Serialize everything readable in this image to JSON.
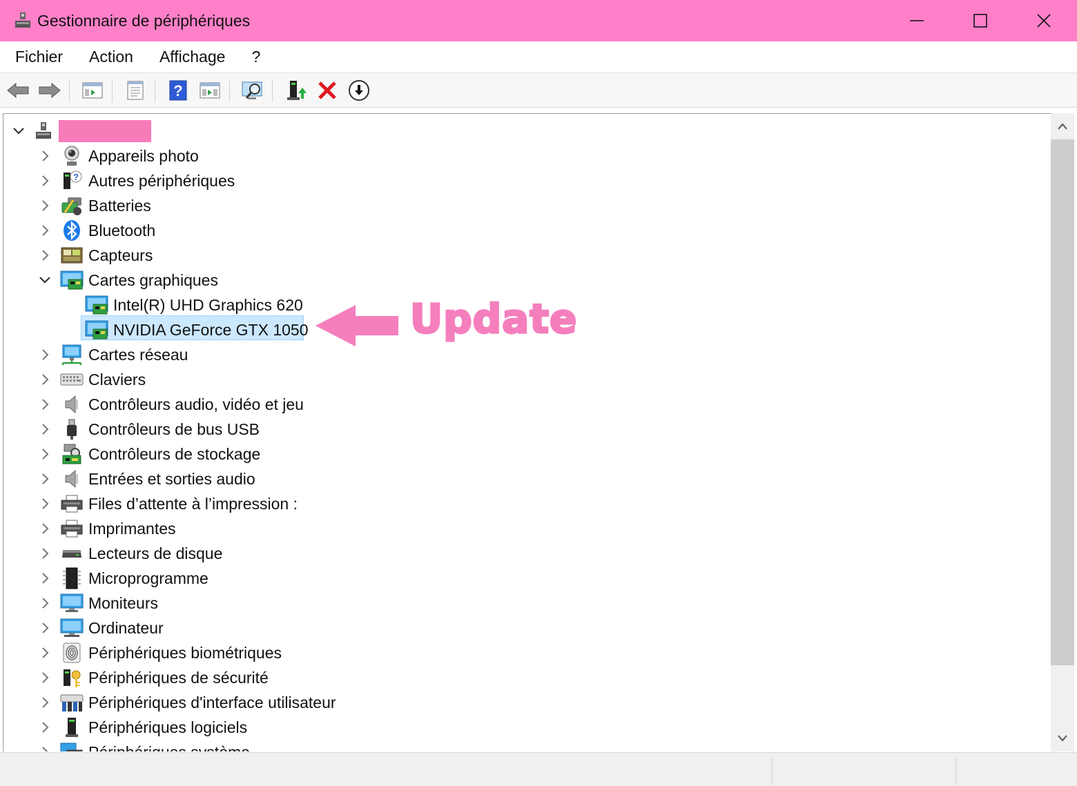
{
  "window": {
    "title": "Gestionnaire de périphériques",
    "icon": "device-manager-icon",
    "title_bar_color": "#ff80c8"
  },
  "menu": [
    "Fichier",
    "Action",
    "Affichage",
    "?"
  ],
  "toolbar": {
    "buttons": [
      "back-arrow-icon",
      "forward-arrow-icon",
      "show-hide-tree-icon",
      "properties-icon",
      "help-icon",
      "show-view-icon",
      "scan-hardware-icon",
      "update-driver-icon",
      "uninstall-icon",
      "disable-device-icon"
    ]
  },
  "tree": {
    "root_label": "",
    "redaction_color": "#f77ab9",
    "categories": [
      {
        "label": "Appareils photo",
        "icon": "camera-icon"
      },
      {
        "label": "Autres périphériques",
        "icon": "unknown-device-icon"
      },
      {
        "label": "Batteries",
        "icon": "battery-icon"
      },
      {
        "label": "Bluetooth",
        "icon": "bluetooth-icon"
      },
      {
        "label": "Capteurs",
        "icon": "sensor-icon"
      },
      {
        "label": "Cartes graphiques",
        "icon": "display-adapter-icon",
        "expanded": true,
        "children": [
          {
            "label": "Intel(R) UHD Graphics 620",
            "icon": "display-adapter-icon"
          },
          {
            "label": "NVIDIA GeForce GTX 1050",
            "icon": "display-adapter-icon",
            "selected": true
          }
        ]
      },
      {
        "label": "Cartes réseau",
        "icon": "network-adapter-icon"
      },
      {
        "label": "Claviers",
        "icon": "keyboard-icon"
      },
      {
        "label": "Contrôleurs audio, vidéo et jeu",
        "icon": "speaker-icon"
      },
      {
        "label": "Contrôleurs de bus USB",
        "icon": "usb-icon"
      },
      {
        "label": "Contrôleurs de stockage",
        "icon": "storage-controller-icon"
      },
      {
        "label": "Entrées et sorties audio",
        "icon": "speaker-icon"
      },
      {
        "label": "Files d’attente à l’impression :",
        "icon": "printer-icon"
      },
      {
        "label": "Imprimantes",
        "icon": "printer-icon"
      },
      {
        "label": "Lecteurs de disque",
        "icon": "disk-drive-icon"
      },
      {
        "label": "Microprogramme",
        "icon": "chip-icon"
      },
      {
        "label": "Moniteurs",
        "icon": "monitor-icon"
      },
      {
        "label": "Ordinateur",
        "icon": "computer-icon"
      },
      {
        "label": "Périphériques biométriques",
        "icon": "fingerprint-icon"
      },
      {
        "label": "Périphériques de sécurité",
        "icon": "security-key-icon"
      },
      {
        "label": "Périphériques d'interface utilisateur",
        "icon": "hid-icon"
      },
      {
        "label": "Périphériques logiciels",
        "icon": "software-device-icon"
      },
      {
        "label": "Périphériques système",
        "icon": "system-device-icon"
      }
    ]
  },
  "annotation": {
    "text": "Update",
    "color": "#f57fbd"
  }
}
